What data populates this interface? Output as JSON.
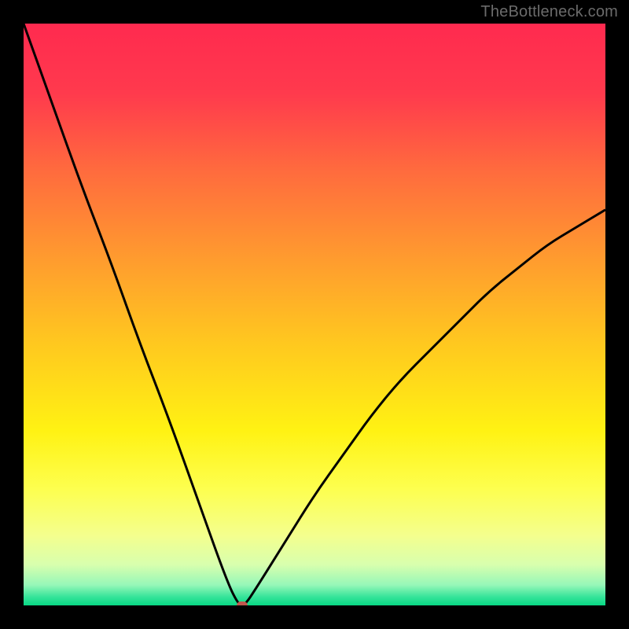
{
  "watermark": "TheBottleneck.com",
  "marker_color": "#c1574e",
  "curve_color": "#000000",
  "curve_width": 3,
  "chart_data": {
    "type": "line",
    "title": "",
    "xlabel": "",
    "ylabel": "",
    "xlim": [
      0,
      100
    ],
    "ylim": [
      0,
      100
    ],
    "grid": false,
    "legend": false,
    "series": [
      {
        "name": "bottleneck-curve",
        "x": [
          0,
          5,
          10,
          15,
          20,
          25,
          30,
          35,
          37,
          38,
          40,
          45,
          50,
          55,
          60,
          65,
          70,
          75,
          80,
          85,
          90,
          95,
          100
        ],
        "values": [
          100,
          86,
          72,
          59,
          45,
          32,
          18,
          4,
          0,
          0,
          3,
          11,
          19,
          26,
          33,
          39,
          44,
          49,
          54,
          58,
          62,
          65,
          68
        ]
      }
    ],
    "marker": {
      "x": 37.5,
      "y": 0
    },
    "gradient_stops": [
      {
        "pos": 0.0,
        "color": "#ff2a4f"
      },
      {
        "pos": 0.12,
        "color": "#ff3a4d"
      },
      {
        "pos": 0.25,
        "color": "#ff6a3e"
      },
      {
        "pos": 0.4,
        "color": "#ff9a2f"
      },
      {
        "pos": 0.55,
        "color": "#ffc81f"
      },
      {
        "pos": 0.7,
        "color": "#fff213"
      },
      {
        "pos": 0.8,
        "color": "#fdff4f"
      },
      {
        "pos": 0.88,
        "color": "#f4ff8e"
      },
      {
        "pos": 0.93,
        "color": "#d8ffae"
      },
      {
        "pos": 0.965,
        "color": "#96f7b8"
      },
      {
        "pos": 0.985,
        "color": "#37e49a"
      },
      {
        "pos": 1.0,
        "color": "#08d884"
      }
    ]
  }
}
